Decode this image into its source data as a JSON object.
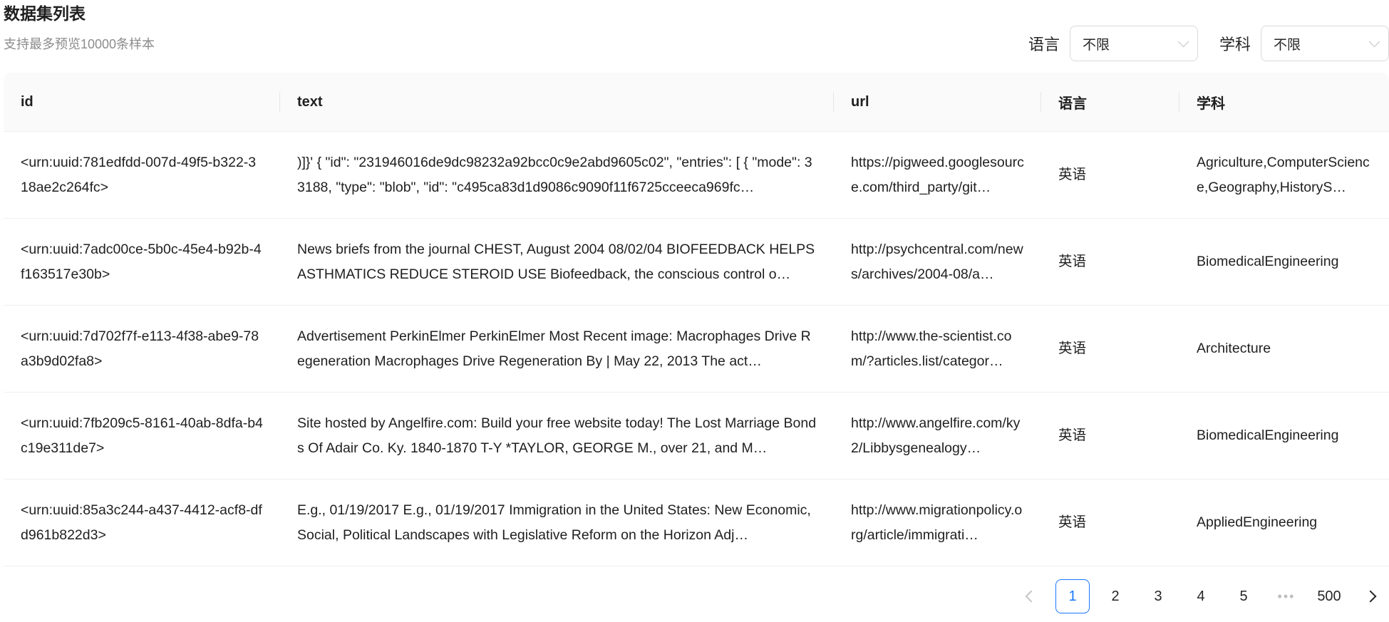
{
  "header": {
    "title": "数据集列表",
    "subtitle": "支持最多预览10000条样本"
  },
  "filters": {
    "language": {
      "label": "语言",
      "value": "不限"
    },
    "subject": {
      "label": "学科",
      "value": "不限"
    }
  },
  "table": {
    "columns": [
      "id",
      "text",
      "url",
      "语言",
      "学科"
    ],
    "rows": [
      {
        "id": "<urn:uuid:781edfdd-007d-49f5-b322-318ae2c264fc>",
        "text": ")]}' { \"id\": \"231946016de9dc98232a92bcc0c9e2abd9605c02\", \"entries\": [ { \"mode\": 33188, \"type\": \"blob\", \"id\": \"c495ca83d1d9086c9090f11f6725cceeca969fc…",
        "url": "https://pigweed.googlesource.com/third_party/git…",
        "language": "英语",
        "subject": "Agriculture,ComputerScience,Geography,HistoryS…"
      },
      {
        "id": "<urn:uuid:7adc00ce-5b0c-45e4-b92b-4f163517e30b>",
        "text": "News briefs from the journal CHEST, August 2004 08/02/04 BIOFEEDBACK HELPS ASTHMATICS REDUCE STEROID USE Biofeedback, the conscious control o…",
        "url": "http://psychcentral.com/news/archives/2004-08/a…",
        "language": "英语",
        "subject": "BiomedicalEngineering"
      },
      {
        "id": "<urn:uuid:7d702f7f-e113-4f38-abe9-78a3b9d02fa8>",
        "text": "Advertisement PerkinElmer PerkinElmer Most Recent image: Macrophages Drive Regeneration Macrophages Drive Regeneration By | May 22, 2013 The act…",
        "url": "http://www.the-scientist.com/?articles.list/categor…",
        "language": "英语",
        "subject": "Architecture"
      },
      {
        "id": "<urn:uuid:7fb209c5-8161-40ab-8dfa-b4c19e311de7>",
        "text": "Site hosted by Angelfire.com: Build your free website today! The Lost Marriage Bonds Of Adair Co. Ky. 1840-1870 T-Y *TAYLOR, GEORGE M., over 21, and M…",
        "url": "http://www.angelfire.com/ky2/Libbysgenealogy…",
        "language": "英语",
        "subject": "BiomedicalEngineering"
      },
      {
        "id": "<urn:uuid:85a3c244-a437-4412-acf8-dfd961b822d3>",
        "text": "E.g., 01/19/2017 E.g., 01/19/2017 Immigration in the United States: New Economic, Social, Political Landscapes with Legislative Reform on the Horizon Adj…",
        "url": "http://www.migrationpolicy.org/article/immigrati…",
        "language": "英语",
        "subject": "AppliedEngineering"
      }
    ]
  },
  "pagination": {
    "current": "1",
    "pages": [
      "1",
      "2",
      "3",
      "4",
      "5"
    ],
    "ellipsis": "•••",
    "last": "500"
  },
  "colors": {
    "accent": "#1677ff",
    "header_bg": "#fafafa",
    "border": "#f0f0f0"
  }
}
